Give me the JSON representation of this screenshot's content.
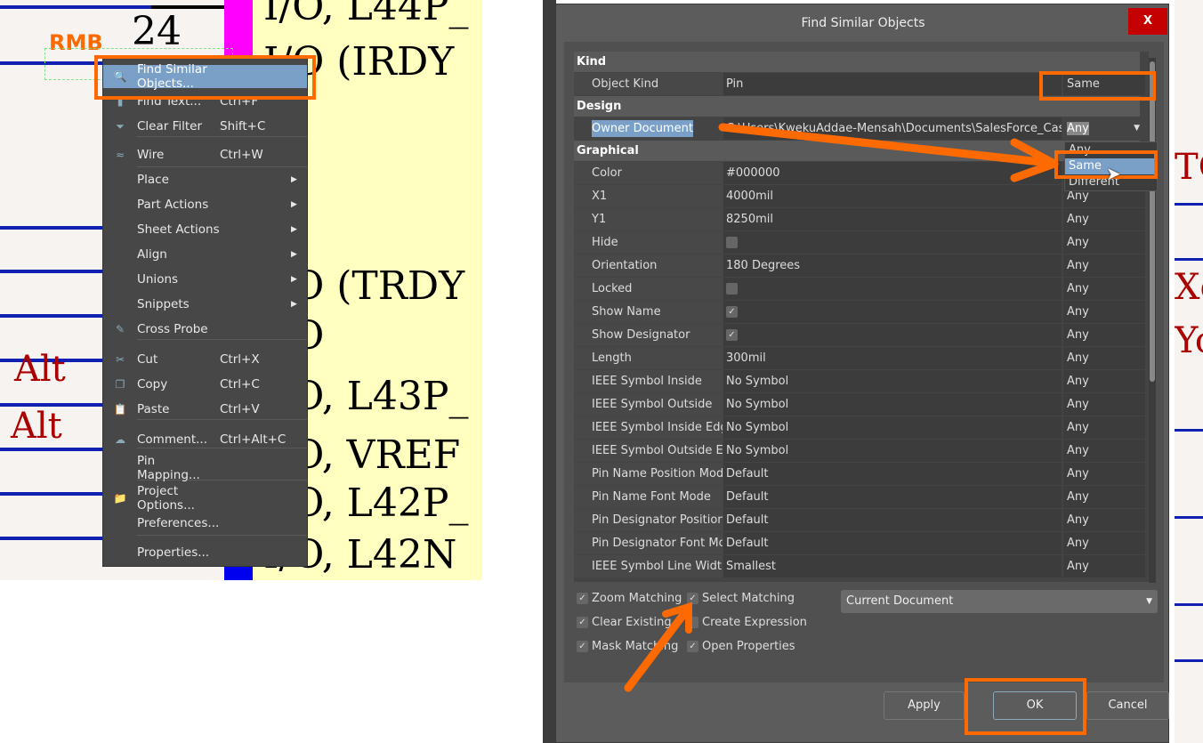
{
  "schematic": {
    "pin_number": "24",
    "rmb_label": "RMB",
    "pin_texts": [
      "I/O, L44P_",
      "I/O (IRDY",
      "I/O (TRDY",
      "I/O",
      "I/O, L43P_",
      "I/O, VREF",
      "I/O, L42P_",
      "I/O, L42N"
    ],
    "alt_labels": [
      "Alt",
      "Alt"
    ],
    "right_texts": [
      "TC",
      "Xo",
      "Yo"
    ]
  },
  "context_menu": {
    "items": [
      {
        "label": "Find Similar Objects...",
        "shortcut": "",
        "icon": "search-icon",
        "highlight": true
      },
      {
        "label": "Find Text...",
        "shortcut": "Ctrl+F",
        "icon": "find-text-icon"
      },
      {
        "label": "Clear Filter",
        "shortcut": "Shift+C",
        "icon": "clear-filter-icon"
      },
      {
        "label": "Wire",
        "shortcut": "Ctrl+W",
        "icon": "wire-icon"
      },
      {
        "label": "Place",
        "submenu": true
      },
      {
        "label": "Part Actions",
        "submenu": true
      },
      {
        "label": "Sheet Actions",
        "submenu": true
      },
      {
        "label": "Align",
        "submenu": true
      },
      {
        "label": "Unions",
        "submenu": true
      },
      {
        "label": "Snippets",
        "submenu": true
      },
      {
        "label": "Cross Probe",
        "icon": "cross-probe-icon"
      },
      {
        "label": "Cut",
        "shortcut": "Ctrl+X",
        "icon": "cut-icon"
      },
      {
        "label": "Copy",
        "shortcut": "Ctrl+C",
        "icon": "copy-icon"
      },
      {
        "label": "Paste",
        "shortcut": "Ctrl+V",
        "icon": "paste-icon"
      },
      {
        "label": "Comment...",
        "shortcut": "Ctrl+Alt+C",
        "icon": "comment-icon"
      },
      {
        "label": "Pin Mapping..."
      },
      {
        "label": "Project Options...",
        "icon": "folder-icon"
      },
      {
        "label": "Preferences..."
      },
      {
        "label": "Properties..."
      }
    ]
  },
  "dialog": {
    "title": "Find Similar Objects",
    "close_label": "X",
    "sections": [
      {
        "header": "Kind",
        "rows": [
          {
            "name": "Object Kind",
            "value": "Pin",
            "match": "Same"
          }
        ]
      },
      {
        "header": "Design",
        "rows": [
          {
            "name": "Owner Document",
            "value": "C:\\Users\\KwekuAddae-Mensah\\Documents\\SalesForce_Cases\\",
            "match": "Any"
          }
        ]
      },
      {
        "header": "Graphical",
        "rows": [
          {
            "name": "Color",
            "value": "#000000",
            "match": "Any"
          },
          {
            "name": "X1",
            "value": "4000mil",
            "match": "Any"
          },
          {
            "name": "Y1",
            "value": "8250mil",
            "match": "Any"
          },
          {
            "name": "Hide",
            "value": "",
            "checkbox": false,
            "match": "Any"
          },
          {
            "name": "Orientation",
            "value": "180 Degrees",
            "match": "Any"
          },
          {
            "name": "Locked",
            "value": "",
            "checkbox": false,
            "match": "Any"
          },
          {
            "name": "Show Name",
            "value": "",
            "checkbox": true,
            "match": "Any"
          },
          {
            "name": "Show Designator",
            "value": "",
            "checkbox": true,
            "match": "Any"
          },
          {
            "name": "Length",
            "value": "300mil",
            "match": "Any"
          },
          {
            "name": "IEEE Symbol Inside",
            "value": "No Symbol",
            "match": "Any"
          },
          {
            "name": "IEEE Symbol Outside",
            "value": "No Symbol",
            "match": "Any"
          },
          {
            "name": "IEEE Symbol Inside Edge",
            "value": "No Symbol",
            "match": "Any"
          },
          {
            "name": "IEEE Symbol Outside Edge",
            "value": "No Symbol",
            "match": "Any"
          },
          {
            "name": "Pin Name Position Mode",
            "value": "Default",
            "match": "Any"
          },
          {
            "name": "Pin Name Font Mode",
            "value": "Default",
            "match": "Any"
          },
          {
            "name": "Pin Designator Position",
            "value": "Default",
            "match": "Any"
          },
          {
            "name": "Pin Designator Font Mode",
            "value": "Default",
            "match": "Any"
          },
          {
            "name": "IEEE Symbol Line Width",
            "value": "Smallest",
            "match": "Any"
          }
        ]
      }
    ],
    "dropdown_options": [
      "Any",
      "Same",
      "Different"
    ],
    "checkboxes": [
      {
        "label": "Zoom Matching",
        "checked": true
      },
      {
        "label": "Select Matching",
        "checked": true
      },
      {
        "label": "Clear Existing",
        "checked": true
      },
      {
        "label": "Create Expression",
        "checked": false
      },
      {
        "label": "Mask Matching",
        "checked": true
      },
      {
        "label": "Open Properties",
        "checked": true
      }
    ],
    "scope": "Current Document",
    "buttons": {
      "apply": "Apply",
      "ok": "OK",
      "cancel": "Cancel"
    }
  }
}
